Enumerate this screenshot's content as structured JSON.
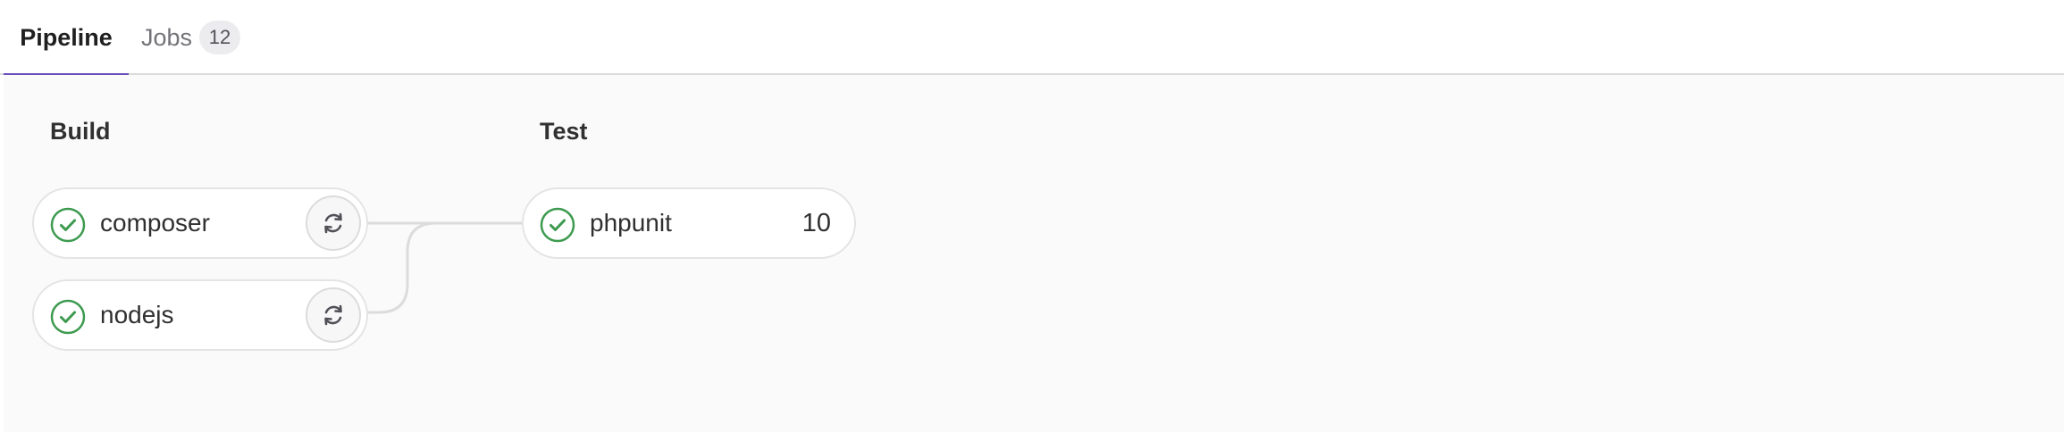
{
  "tabs": {
    "pipeline_label": "Pipeline",
    "jobs_label": "Jobs",
    "jobs_count": "12"
  },
  "stages": {
    "build": {
      "title": "Build",
      "jobs": [
        {
          "name": "composer",
          "status": "passed",
          "status_icon": "check-circle-icon",
          "action_icon": "retry-icon"
        },
        {
          "name": "nodejs",
          "status": "passed",
          "status_icon": "check-circle-icon",
          "action_icon": "retry-icon"
        }
      ]
    },
    "test": {
      "title": "Test",
      "jobs": [
        {
          "name": "phpunit",
          "status": "passed",
          "status_icon": "check-circle-icon",
          "count": "10"
        }
      ]
    }
  },
  "colors": {
    "success": "#3d9a4f",
    "tab_active": "#6b4fbb",
    "connector": "#dcdcde"
  }
}
